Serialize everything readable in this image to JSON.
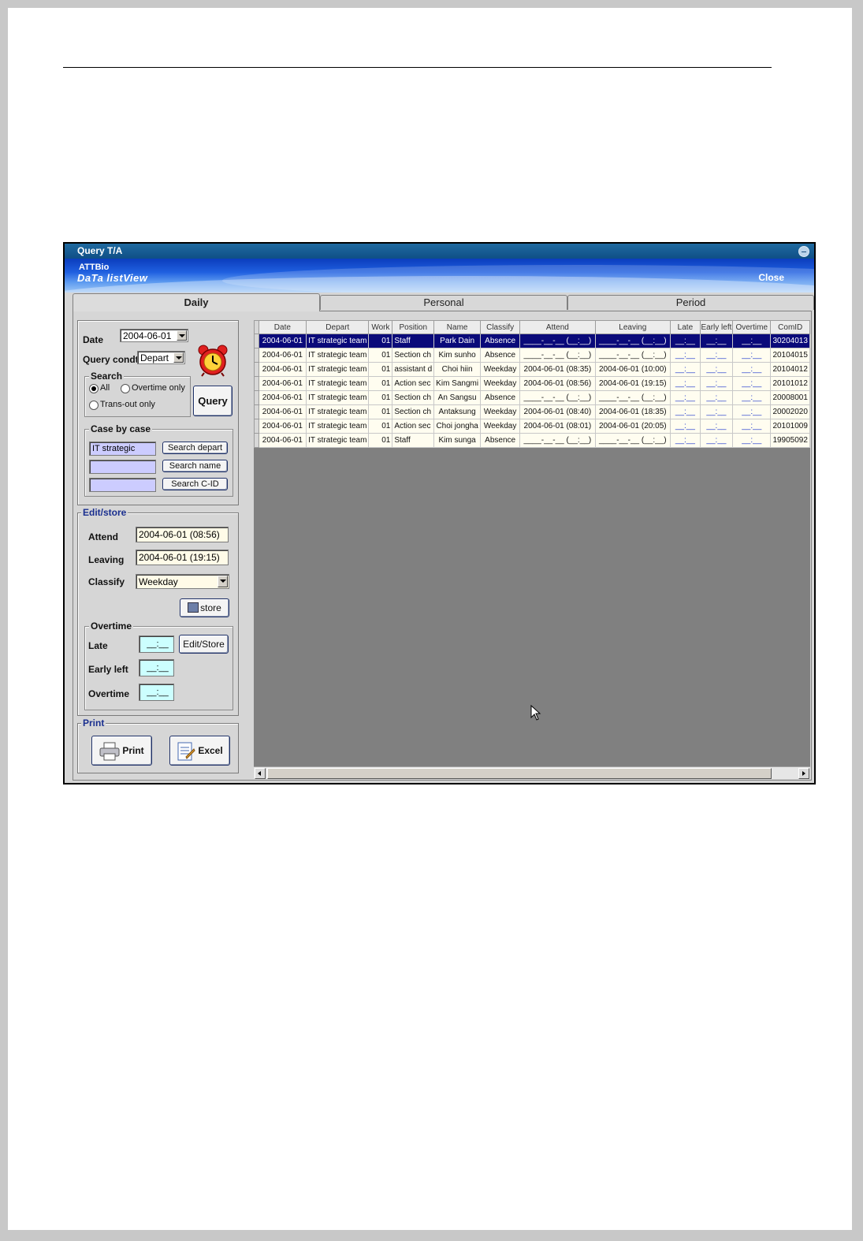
{
  "window": {
    "title": "Query T/A"
  },
  "banner": {
    "brand_top": "ATTBio",
    "brand_bottom": "DaTa listView",
    "close": "Close"
  },
  "tabs": [
    "Daily",
    "Personal",
    "Period"
  ],
  "query_panel": {
    "date_label": "Date",
    "date_value": "2004-06-01",
    "condt_label": "Query condt",
    "condt_value": "Depart",
    "search_legend": "Search",
    "radio_all": "All",
    "radio_overtime": "Overtime only",
    "radio_trans": "Trans-out only",
    "query_button": "Query",
    "case_legend": "Case by case",
    "depart_value": "IT strategic",
    "search_depart": "Search depart",
    "search_name": "Search name",
    "search_cid": "Search C-ID"
  },
  "edit_panel": {
    "legend": "Edit/store",
    "attend_label": "Attend",
    "attend_value": "2004-06-01 (08:56)",
    "leaving_label": "Leaving",
    "leaving_value": "2004-06-01 (19:15)",
    "classify_label": "Classify",
    "classify_value": "Weekday",
    "store_button": "store",
    "overtime_legend": "Overtime",
    "late_label": "Late",
    "late_value": "__:__",
    "edit_store_button": "Edit/Store",
    "early_label": "Early left",
    "early_value": "__:__",
    "overtime_label": "Overtime",
    "overtime_value": "__:__"
  },
  "print_panel": {
    "legend": "Print",
    "print_button": "Print",
    "excel_button": "Excel"
  },
  "grid": {
    "columns": [
      "Date",
      "Depart",
      "Work",
      "Position",
      "Name",
      "Classify",
      "Attend",
      "Leaving",
      "Late",
      "Early left",
      "Overtime",
      "ComID"
    ],
    "rows": [
      [
        "2004-06-01",
        "IT strategic team",
        "01",
        "Staff",
        "Park Dain",
        "Absence",
        "____-__-__ (__:__)",
        "____-__-__ (__:__)",
        "__:__",
        "__:__",
        "__:__",
        "30204013"
      ],
      [
        "2004-06-01",
        "IT strategic team",
        "01",
        "Section ch",
        "Kim sunho",
        "Absence",
        "____-__-__ (__:__)",
        "____-__-__ (__:__)",
        "__:__",
        "__:__",
        "__:__",
        "20104015"
      ],
      [
        "2004-06-01",
        "IT strategic team",
        "01",
        "assistant d",
        "Choi hiin",
        "Weekday",
        "2004-06-01 (08:35)",
        "2004-06-01 (10:00)",
        "__:__",
        "__:__",
        "__:__",
        "20104012"
      ],
      [
        "2004-06-01",
        "IT strategic team",
        "01",
        "Action sec",
        "Kim Sangmi",
        "Weekday",
        "2004-06-01 (08:56)",
        "2004-06-01 (19:15)",
        "__:__",
        "__:__",
        "__:__",
        "20101012"
      ],
      [
        "2004-06-01",
        "IT strategic team",
        "01",
        "Section ch",
        "An Sangsu",
        "Absence",
        "____-__-__ (__:__)",
        "____-__-__ (__:__)",
        "__:__",
        "__:__",
        "__:__",
        "20008001"
      ],
      [
        "2004-06-01",
        "IT strategic team",
        "01",
        "Section ch",
        "Antaksung",
        "Weekday",
        "2004-06-01 (08:40)",
        "2004-06-01 (18:35)",
        "__:__",
        "__:__",
        "__:__",
        "20002020"
      ],
      [
        "2004-06-01",
        "IT strategic team",
        "01",
        "Action sec",
        "Choi jongha",
        "Weekday",
        "2004-06-01 (08:01)",
        "2004-06-01 (20:05)",
        "__:__",
        "__:__",
        "__:__",
        "20101009"
      ],
      [
        "2004-06-01",
        "IT strategic team",
        "01",
        "Staff",
        "Kim sunga",
        "Absence",
        "____-__-__ (__:__)",
        "____-__-__ (__:__)",
        "__:__",
        "__:__",
        "__:__",
        "19905092"
      ]
    ]
  }
}
